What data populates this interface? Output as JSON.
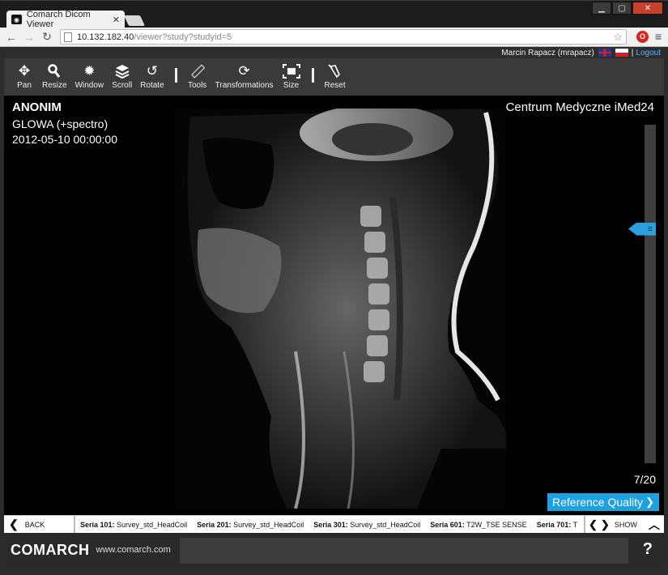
{
  "browser": {
    "tab_title": "Comarch Dicom Viewer",
    "url_host": "10.132.182.40",
    "url_path": "/viewer?study?studyid=5"
  },
  "user": {
    "name": "Marcin Rapacz (mrapacz)",
    "logout": "Logout"
  },
  "toolbar": [
    {
      "label": "Pan",
      "icon": "move-icon"
    },
    {
      "label": "Resize",
      "icon": "zoom-icon"
    },
    {
      "label": "Window",
      "icon": "sun-icon"
    },
    {
      "label": "Scroll",
      "icon": "layers-icon"
    },
    {
      "label": "Rotate",
      "icon": "rotate-icon"
    },
    {
      "label": "Tools",
      "icon": "ruler-icon"
    },
    {
      "label": "Transformations",
      "icon": "refresh-icon"
    },
    {
      "label": "Size",
      "icon": "fit-icon"
    },
    {
      "label": "Reset",
      "icon": "eraser-icon"
    }
  ],
  "overlay": {
    "patient": "ANONIM",
    "study": "GLOWA (+spectro)",
    "date": "2012-05-10 00:00:00",
    "institution": "Centrum Medyczne iMed24",
    "slice": "7/20",
    "slice_position_fraction": 0.3,
    "quality": "Reference Quality"
  },
  "series_bar": {
    "back": "BACK",
    "show": "SHOW",
    "series": [
      {
        "id": "Seria 101:",
        "name": "Survey_std_HeadCoil"
      },
      {
        "id": "Seria 201:",
        "name": "Survey_std_HeadCoil"
      },
      {
        "id": "Seria 301:",
        "name": "Survey_std_HeadCoil"
      },
      {
        "id": "Seria 601:",
        "name": "T2W_TSE SENSE"
      },
      {
        "id": "Seria 701:",
        "name": "T"
      }
    ]
  },
  "footer": {
    "brand": "COMARCH",
    "site": "www.comarch.com",
    "help": "?"
  },
  "colors": {
    "accent": "#1da1e0",
    "toolbar": "#3a3a3a",
    "viewer_bg": "#000000"
  }
}
